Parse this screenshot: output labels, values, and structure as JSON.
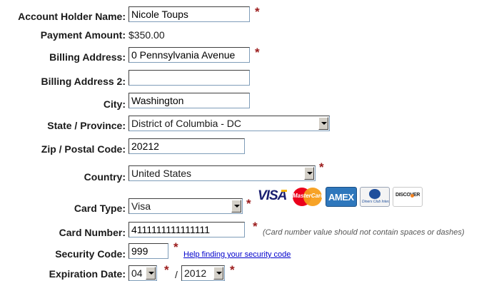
{
  "labels": {
    "account_holder": "Account Holder Name:",
    "payment_amount": "Payment Amount:",
    "billing_address": "Billing Address:",
    "billing_address2": "Billing Address 2:",
    "city": "City:",
    "state": "State / Province:",
    "zip": "Zip / Postal Code:",
    "country": "Country:",
    "card_type": "Card Type:",
    "card_number": "Card Number:",
    "security_code": "Security Code:",
    "expiration": "Expiration Date:"
  },
  "values": {
    "account_holder": "Nicole Toups",
    "payment_amount": "$350.00",
    "billing_address": "0 Pennsylvania Avenue",
    "billing_address2": "",
    "city": "Washington",
    "state": "District of Columbia - DC",
    "zip": "20212",
    "country": "United States",
    "card_type": "Visa",
    "card_number": "4111111111111111",
    "security_code": "999",
    "exp_month": "04",
    "exp_year": "2012"
  },
  "required_mark": "*",
  "slash": "/",
  "card_number_note": "(Card number value should not contain spaces or dashes)",
  "security_help_link": "Help finding your security code",
  "card_logos": {
    "visa": "VISA",
    "mastercard": "MasterCard",
    "amex": "AMEX",
    "diners": "Diners Club International",
    "discover": "DISCOVER"
  },
  "colors": {
    "required": "#9b1b1b",
    "link": "#0000cc",
    "visa_blue": "#1a1f71",
    "visa_gold": "#f7b600",
    "mc_red": "#eb001b",
    "mc_orange": "#f79e1b",
    "amex_blue": "#2e77bc",
    "discover_orange": "#f58220"
  }
}
